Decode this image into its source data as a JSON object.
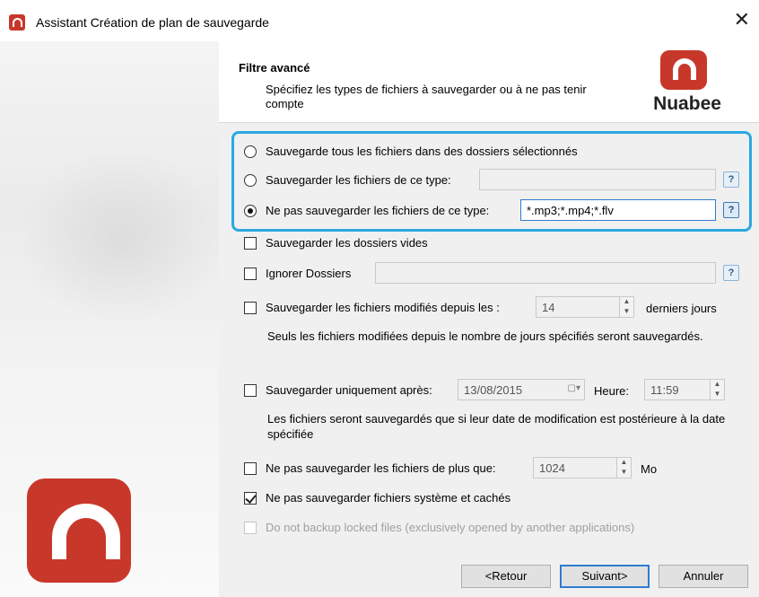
{
  "window": {
    "title": "Assistant Création de plan de sauvegarde",
    "close_glyph": "✕"
  },
  "branding": {
    "logo_text": "Nuabee",
    "brand_color": "#c8382a"
  },
  "header": {
    "title": "Filtre avancé",
    "subtitle": "Spécifiez les types de fichiers à sauvegarder ou à ne pas tenir compte"
  },
  "filters": {
    "radio_all": {
      "label": "Sauvegarde tous les fichiers dans des dossiers sélectionnés",
      "selected": false
    },
    "radio_include": {
      "label": "Sauvegarder les fichiers de ce type:",
      "value": "",
      "selected": false
    },
    "radio_exclude": {
      "label": "Ne pas sauvegarder les fichiers de ce type:",
      "value": "*.mp3;*.mp4;*.flv",
      "selected": true
    },
    "help_glyph": "?"
  },
  "options": {
    "empty_folders": {
      "label": "Sauvegarder les dossiers vides",
      "checked": false
    },
    "ignore_folders": {
      "label": "Ignorer Dossiers",
      "value": "",
      "checked": false
    },
    "modified_since": {
      "label": "Sauvegarder les fichiers modifiés depuis les :",
      "value": "14",
      "suffix": "derniers jours",
      "checked": false,
      "note": "Seuls les fichiers modifiées depuis le nombre de jours spécifiés seront sauvegardés."
    },
    "only_after": {
      "label": "Sauvegarder uniquement après:",
      "date": "13/08/2015",
      "time_label": "Heure:",
      "time": "11:59",
      "checked": false,
      "note": "Les fichiers seront sauvegardés que si leur date de modification est postérieure à la date spécifiée"
    },
    "max_size": {
      "label": "Ne pas sauvegarder les fichiers de plus que:",
      "value": "1024",
      "unit": "Mo",
      "checked": false
    },
    "system_hidden": {
      "label": "Ne pas sauvegarder fichiers système et cachés",
      "checked": true
    },
    "locked_files": {
      "label": "Do not backup locked files (exclusively opened by another applications)",
      "checked": false,
      "enabled": false
    }
  },
  "buttons": {
    "back": "<Retour",
    "next": "Suivant>",
    "cancel": "Annuler"
  },
  "colors": {
    "highlight": "#2ba8e0",
    "accent": "#2f7bd1"
  }
}
